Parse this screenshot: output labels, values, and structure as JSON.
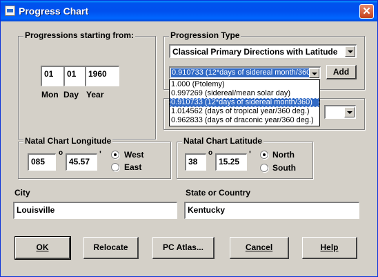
{
  "window": {
    "title": "Progress Chart"
  },
  "start_group": {
    "label": "Progressions starting from:",
    "month": "01",
    "day": "01",
    "year": "1960",
    "month_label": "Mon",
    "day_label": "Day",
    "year_label": "Year"
  },
  "type_group": {
    "label": "Progression Type",
    "selected_type": "Classical Primary Directions with Latitude",
    "key_value": "0.910733 (12*days of sidereal month/360)",
    "add_label": "Add",
    "key_options": [
      "1.000 (Ptolemy)",
      "0.997269 (sidereal/mean solar day)",
      "0.910733 (12*days of sidereal month/360)",
      "1.014562 (days of tropical year/360 deg.)",
      "0.962833 (days of draconic year/360 deg.)"
    ],
    "selected_index": 2
  },
  "longitude": {
    "label": "Natal Chart Longitude",
    "degrees": "085",
    "minutes": "45.57",
    "deg_symbol": "o",
    "min_symbol": "'",
    "west_label": "West",
    "east_label": "East",
    "selected": "West"
  },
  "latitude": {
    "label": "Natal Chart Latitude",
    "degrees": "38",
    "minutes": "15.25",
    "deg_symbol": "o",
    "min_symbol": "'",
    "north_label": "North",
    "south_label": "South",
    "selected": "North"
  },
  "city": {
    "label": "City",
    "value": "Louisville"
  },
  "state": {
    "label": "State or Country",
    "value": "Kentucky"
  },
  "buttons": {
    "ok": "OK",
    "relocate": "Relocate",
    "atlas": "PC Atlas...",
    "cancel": "Cancel",
    "help": "Help"
  },
  "colors": {
    "title_bar": "#0054e3",
    "selection": "#316ac5",
    "face": "#d4d0c8"
  }
}
